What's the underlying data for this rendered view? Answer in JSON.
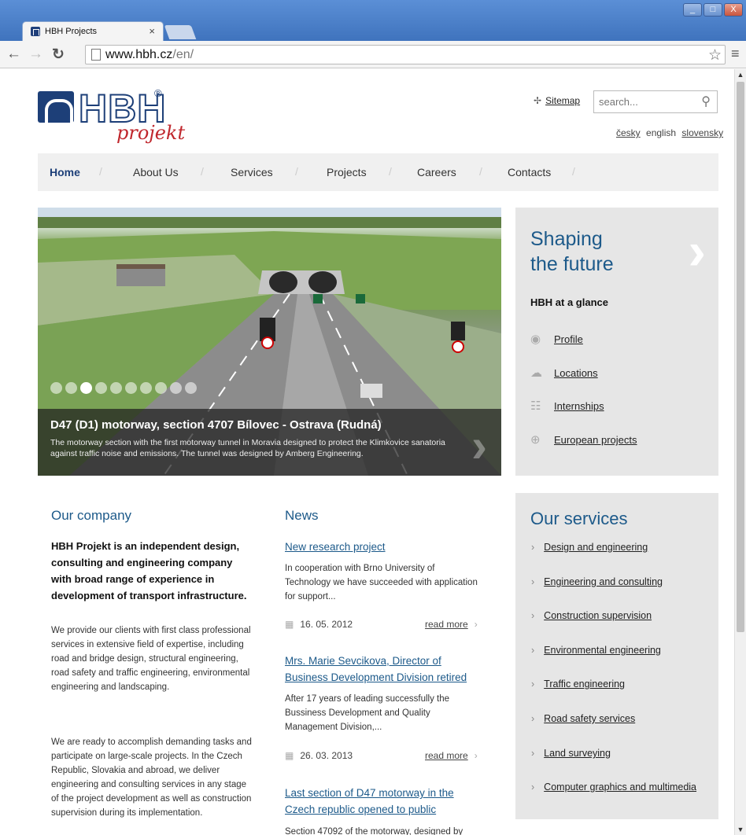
{
  "browser": {
    "tab_title": "HBH Projects",
    "tab_close": "×",
    "url_host": "www.hbh.cz",
    "url_path": "/en/",
    "window_buttons": [
      "_",
      "□",
      "X"
    ]
  },
  "header": {
    "logo_letters": "HBH",
    "logo_reg": "®",
    "logo_script": "projekt",
    "sitemap_label": "Sitemap",
    "search_placeholder": "search...",
    "languages": [
      "česky",
      "english",
      "slovensky"
    ],
    "current_language": "english"
  },
  "nav": {
    "items": [
      "Home",
      "About Us",
      "Services",
      "Projects",
      "Careers",
      "Contacts"
    ],
    "active": "Home"
  },
  "hero": {
    "slide_count": 10,
    "active_slide": 3,
    "title": "D47 (D1) motorway, section 4707 Bílovec - Ostrava (Rudná)",
    "text": "The motorway section with the first motorway tunnel in Moravia designed to protect the Klimkovice sanatoria against traffic noise and emissions. The tunnel was designed by Amberg Engineering."
  },
  "glance": {
    "title_line1": "Shaping",
    "title_line2": "the future",
    "subtitle": "HBH at a glance",
    "links": [
      {
        "label": "Profile",
        "icon": "profile-icon"
      },
      {
        "label": "Locations",
        "icon": "locations-icon"
      },
      {
        "label": "Internships",
        "icon": "internships-icon"
      },
      {
        "label": "European projects",
        "icon": "globe-icon"
      }
    ]
  },
  "company": {
    "heading": "Our company",
    "intro": "HBH Projekt is an independent design, consulting and engineering company with broad range of experience in development of transport infrastructure.",
    "p1": "We provide our clients with first class professional services in extensive field of expertise, including road and bridge design, structural engineering, road safety and traffic engineering, environmental engineering and landscaping.",
    "p2": "We are ready to accomplish demanding tasks and participate on large-scale projects. In the Czech Republic, Slovakia and abroad, we deliver engineering and consulting services in any stage of the project development as well as construction supervision during its implementation."
  },
  "news": {
    "heading": "News",
    "read_more": "read more",
    "items": [
      {
        "title": "New research project",
        "text": "In cooperation with Brno University of Technology we have succeeded with application for support...",
        "date": "16. 05. 2012"
      },
      {
        "title": "Mrs. Marie Sevcikova, Director of Business Development Division retired",
        "text": "After 17 years of leading successfully the Bussiness Development and Quality Management Division,...",
        "date": "26. 03. 2013"
      },
      {
        "title": "Last section of D47 motorway in the Czech republic opened to public",
        "text": "Section 47092 of the motorway, designed by"
      }
    ]
  },
  "services": {
    "heading": "Our services",
    "items": [
      "Design and engineering",
      "Engineering and consulting",
      "Construction supervision",
      "Environmental engineering",
      "Traffic engineering",
      "Road safety services",
      "Land surveying",
      "Computer graphics and multimedia"
    ]
  }
}
